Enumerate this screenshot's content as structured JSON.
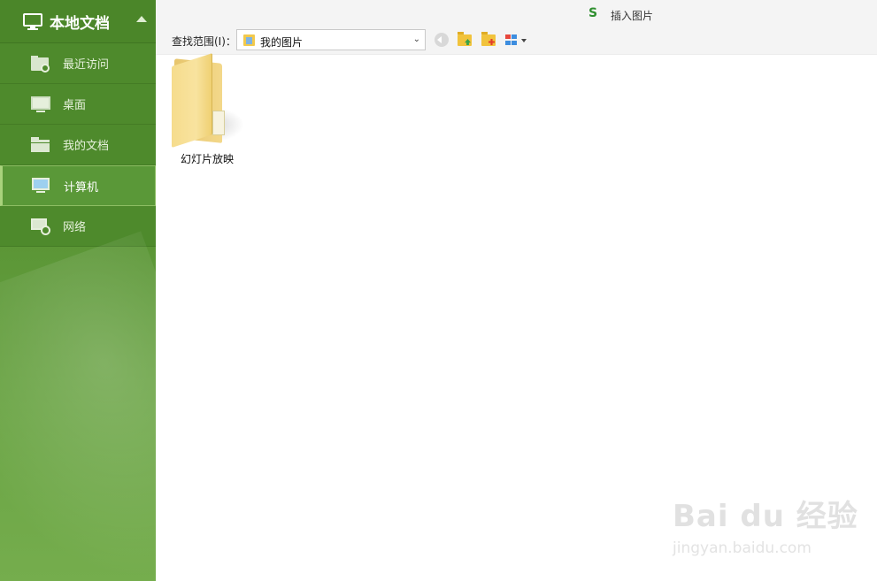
{
  "sidebar": {
    "header": {
      "title": "本地文档",
      "icon": "monitor-icon"
    },
    "items": [
      {
        "label": "最近访问",
        "icon": "recent-folder-icon",
        "active": false
      },
      {
        "label": "桌面",
        "icon": "desktop-icon",
        "active": false
      },
      {
        "label": "我的文档",
        "icon": "documents-folder-icon",
        "active": false
      },
      {
        "label": "计算机",
        "icon": "computer-icon",
        "active": true
      },
      {
        "label": "网络",
        "icon": "network-icon",
        "active": false
      }
    ]
  },
  "window": {
    "logo": "S",
    "title": "插入图片"
  },
  "toolbar": {
    "search_label": "查找范围(I)：",
    "location_value": "我的图片",
    "buttons": [
      "back-icon",
      "up-folder-icon",
      "new-folder-icon",
      "view-menu-icon"
    ]
  },
  "files": [
    {
      "name": "幻灯片放映",
      "type": "folder"
    }
  ],
  "watermark": {
    "brand": "Bai du 经验",
    "url": "jingyan.baidu.com"
  },
  "colors": {
    "sidebar_green": "#4f8a2c",
    "accent_green": "#2f8f2f"
  }
}
